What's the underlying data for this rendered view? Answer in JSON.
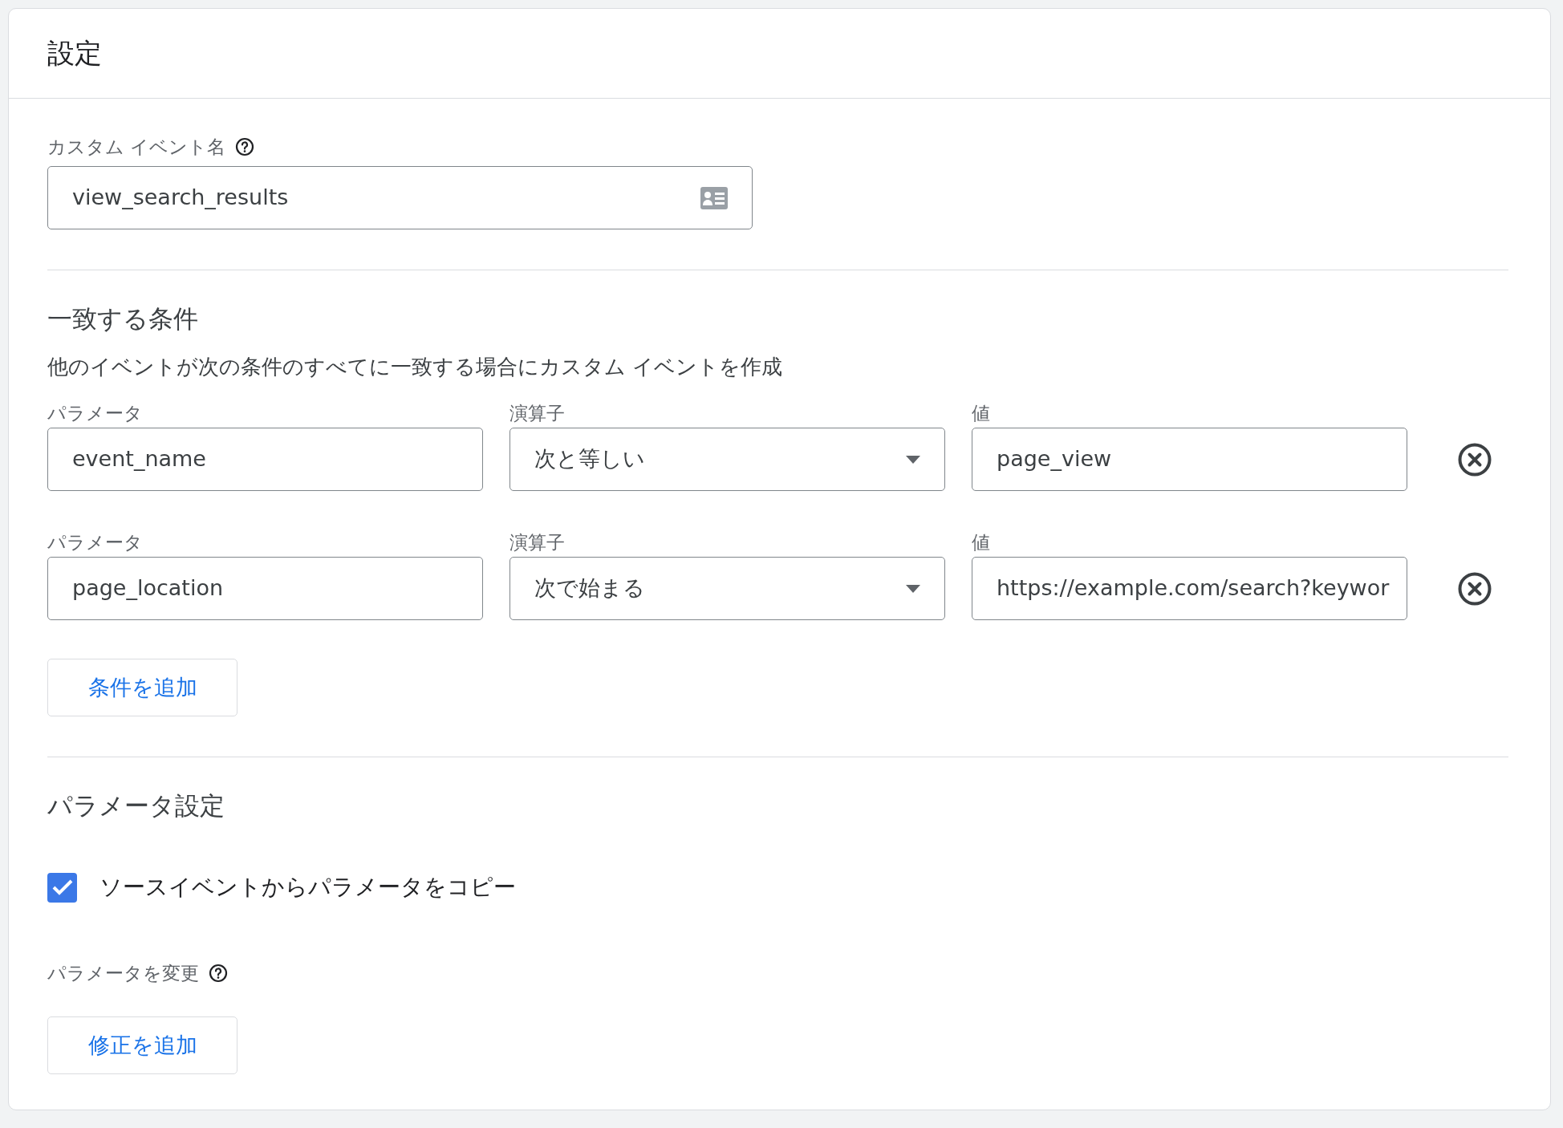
{
  "header": {
    "title": "設定"
  },
  "custom_event_name": {
    "label": "カスタム イベント名",
    "value": "view_search_results"
  },
  "matching_conditions": {
    "title": "一致する条件",
    "description": "他のイベントが次の条件のすべてに一致する場合にカスタム イベントを作成",
    "conditions": [
      {
        "parameter_label": "パラメータ",
        "parameter": "event_name",
        "operator_label": "演算子",
        "operator": "次と等しい",
        "value_label": "値",
        "value": "page_view"
      },
      {
        "parameter_label": "パラメータ",
        "parameter": "page_location",
        "operator_label": "演算子",
        "operator": "次で始まる",
        "value_label": "値",
        "value": "https://example.com/search?keywor"
      }
    ],
    "add_button": "条件を追加"
  },
  "parameter_settings": {
    "title": "パラメータ設定",
    "copy_from_source": {
      "label": "ソースイベントからパラメータをコピー",
      "checked": true
    },
    "modify_label": "パラメータを変更",
    "add_button": "修正を追加"
  }
}
